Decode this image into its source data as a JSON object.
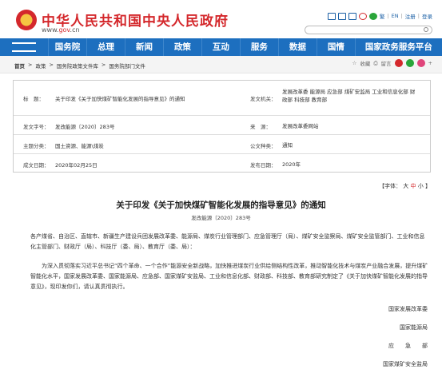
{
  "header": {
    "site_title": "中华人民共和国中央人民政府",
    "site_url_prefix": "www.",
    "site_url_domain": "gov",
    "site_url_suffix": ".cn",
    "links": [
      "繁",
      "EN",
      "注册",
      "登录"
    ]
  },
  "nav": {
    "items": [
      "国务院",
      "总理",
      "新闻",
      "政策",
      "互动",
      "服务",
      "数据",
      "国情",
      "国家政务服务平台"
    ]
  },
  "breadcrumb": [
    "首页",
    ">",
    "政策",
    ">",
    "国务院政策文件库",
    ">",
    "国务院部门文件"
  ],
  "share": {
    "favorite": "收藏",
    "save": "留言"
  },
  "info": {
    "title_label": "标　题：",
    "title_value": "关于印发《关于加快煤矿智能化发展的指导意见》的通知",
    "issuer_label": "发文机关：",
    "issuer_value": "发展改革委 能源局 应急部 煤矿安监局 工业和信息化部 财政部 科技部 教育部",
    "docno_label": "发文字号：",
    "docno_value": "发改能源〔2020〕283号",
    "source_label": "来　源：",
    "source_value": "发展改革委网站",
    "topic_label": "主题分类：",
    "topic_value": "国土资源、能源\\煤炭",
    "type_label": "公文种类：",
    "type_value": "通知",
    "written_label": "成文日期：",
    "written_value": "2020年02月25日",
    "published_label": "发布日期：",
    "published_value": "2020年"
  },
  "fontsize": {
    "prefix": "【字体：",
    "big": "大",
    "mid": "中",
    "small": "小",
    "suffix": "】"
  },
  "article": {
    "title": "关于印发《关于加快煤矿智能化发展的指导意见》的通知",
    "docno": "发改能源〔2020〕283号",
    "p1": "各产煤省、自治区、直辖市、新疆生产建设兵团发展改革委、能源局、煤炭行业管理部门、应急管理厅（局）、煤矿安全监察局、煤矿安全监管部门、工业和信息化主管部门、财政厅（局）、科技厅（委、局）、教育厅（委、局）：",
    "p2": "为深入贯彻落实习近平总书记“四个革命、一个合作”能源安全新战略，加快推进煤炭行业供给侧结构性改革，推动智能化技术与煤炭产业融合发展，提升煤矿智能化水平，国家发展改革委、国家能源局、应急部、国家煤矿安监局、工业和信息化部、财政部、科技部、教育部研究制定了《关于加快煤矿智能化发展的指导意见》，现印发你们，请认真贯彻执行。",
    "signatures": [
      "国家发展改革委",
      "国家能源局",
      "应　　急　　部",
      "国家煤矿安全监局"
    ]
  }
}
